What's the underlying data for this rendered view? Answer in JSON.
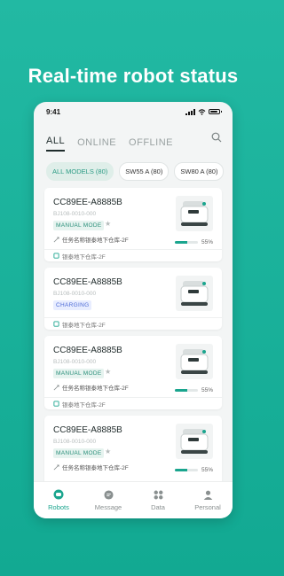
{
  "headline": "Real-time robot status",
  "status": {
    "time": "9:41"
  },
  "tabs": [
    {
      "label": "ALL",
      "active": true
    },
    {
      "label": "ONLINE",
      "active": false
    },
    {
      "label": "OFFLINE",
      "active": false
    }
  ],
  "filters": [
    {
      "label": "ALL MODELS (80)",
      "active": true
    },
    {
      "label": "SW55 A (80)",
      "active": false
    },
    {
      "label": "SW80 A (80)",
      "active": false
    }
  ],
  "robots": [
    {
      "name": "CC89EE-A8885B",
      "serial": "BJ108-0010-000",
      "mode": "MANUAL MODE",
      "task": "任务名称银泰地下仓库-2F",
      "progress_pct": 55,
      "progress_label": "55%",
      "location": "银泰地下仓库-2F"
    },
    {
      "name": "CC89EE-A8885B",
      "serial": "BJ108-0010-000",
      "mode": "CHARGING",
      "location": "银泰地下仓库-2F"
    },
    {
      "name": "CC89EE-A8885B",
      "serial": "BJ108-0010-000",
      "mode": "MANUAL MODE",
      "task": "任务名称银泰地下仓库-2F",
      "progress_pct": 55,
      "progress_label": "55%",
      "location": "银泰地下仓库-2F"
    },
    {
      "name": "CC89EE-A8885B",
      "serial": "BJ108-0010-000",
      "mode": "MANUAL MODE",
      "task": "任务名称银泰地下仓库-2F",
      "progress_pct": 55,
      "progress_label": "55%"
    }
  ],
  "tabbar": [
    {
      "label": "Robots",
      "icon": "robot-icon",
      "active": true
    },
    {
      "label": "Message",
      "icon": "message-icon",
      "active": false
    },
    {
      "label": "Data",
      "icon": "data-grid-icon",
      "active": false
    },
    {
      "label": "Personal",
      "icon": "person-icon",
      "active": false
    }
  ],
  "colors": {
    "brand": "#1aa58e",
    "background": "#22b9a3"
  }
}
